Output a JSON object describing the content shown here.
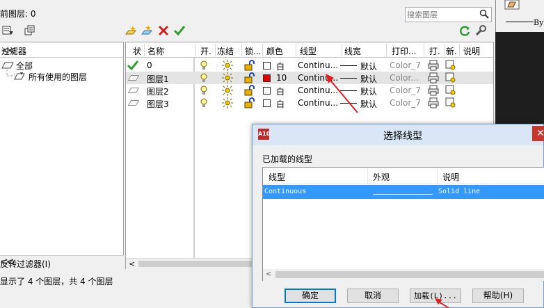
{
  "layer_manager": {
    "current_layer_label": "前图层: 0",
    "search": {
      "placeholder": "搜索图层"
    },
    "filter_tree": {
      "header": "过滤器",
      "items": [
        "全部",
        "所有使用的图层"
      ],
      "invert_filter_label": "反转过滤器(I)"
    },
    "columns": [
      "状",
      "名称",
      "开.",
      "冻结",
      "锁...",
      "颜色",
      "线型",
      "线宽",
      "打印...",
      "打.",
      "新.",
      "说明"
    ],
    "layers": [
      {
        "name": "0",
        "color_name": "白",
        "linetype": "Continu...",
        "lineweight": "默认",
        "plot_style": "Color_7",
        "current": true,
        "selected": false
      },
      {
        "name": "图层1",
        "color_name": "10",
        "linetype": "Continu...",
        "lineweight": "默认",
        "plot_style": "Color...",
        "current": false,
        "selected": true
      },
      {
        "name": "图层2",
        "color_name": "白",
        "linetype": "Continu...",
        "lineweight": "默认",
        "plot_style": "Color_7",
        "current": false,
        "selected": false
      },
      {
        "name": "图层3",
        "color_name": "白",
        "linetype": "Continu...",
        "lineweight": "默认",
        "plot_style": "Color_7",
        "current": false,
        "selected": false
      }
    ],
    "status": "显示了 4 个图层，共 4 个图层"
  },
  "right_strip": {
    "label": "ByL"
  },
  "linetype_dialog": {
    "title": "选择线型",
    "close_glyph": "✕",
    "app_icon_text": "A10",
    "loaded_label": "已加载的线型",
    "columns": [
      "线型",
      "外观",
      "说明"
    ],
    "rows": [
      {
        "linetype": "Continuous",
        "description": "Solid line"
      }
    ],
    "buttons": {
      "ok": "确定",
      "cancel": "取消",
      "load": "加载(L)...",
      "help": "帮助(H)"
    }
  },
  "colors": {
    "accent": "#3399ff",
    "selected_color": "#e00000",
    "arrow": "#e02020"
  }
}
